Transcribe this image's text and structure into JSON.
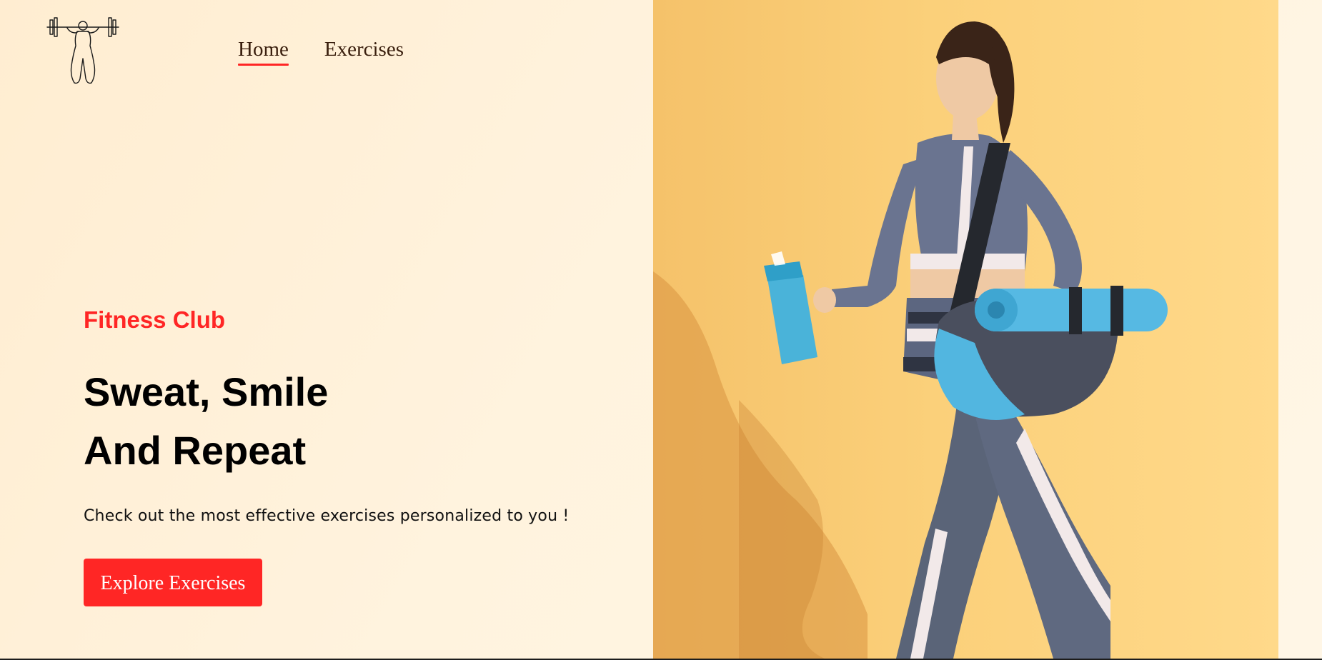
{
  "brand": {
    "logo_icon": "weightlifter-icon"
  },
  "nav": {
    "items": [
      {
        "label": "Home",
        "active": true
      },
      {
        "label": "Exercises",
        "active": false
      }
    ]
  },
  "hero": {
    "eyebrow": "Fitness Club",
    "title_line1": "Sweat, Smile",
    "title_line2": "And Repeat",
    "subtitle": "Check out the most effective exercises personalized to you !",
    "cta_label": "Explore Exercises",
    "image_icon": "woman-athlete-with-yoga-mat-and-shaker-photo"
  },
  "colors": {
    "accent": "#ff2625",
    "background": "#fff3dd",
    "image_background": "#fbd07a",
    "text": "#000000"
  }
}
